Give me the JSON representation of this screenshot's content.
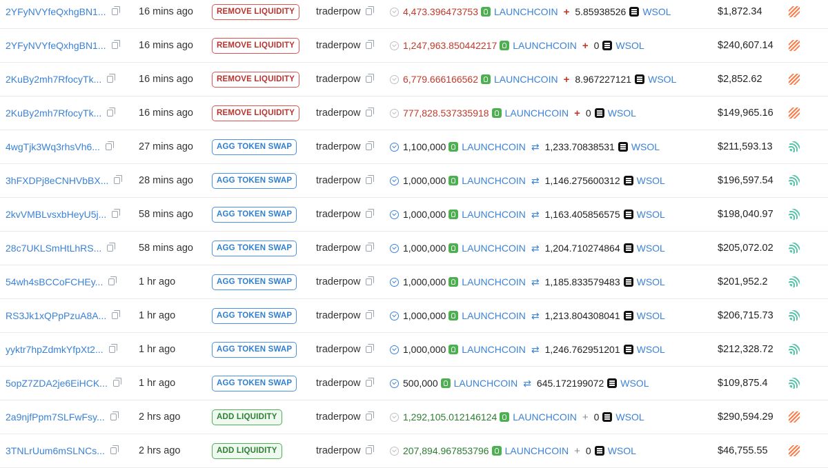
{
  "rows": [
    {
      "sig": "2YFyNVYfeQxhgBN1...",
      "time": "16 mins ago",
      "type": "REMOVE LIQUIDITY",
      "kind": "remove",
      "by": "traderpow",
      "amt1": "4,473.396473753",
      "tok1": "LAUNCHCOIN",
      "op": "+",
      "amt2": "5.85938526",
      "tok2": "WSOL",
      "value": "$1,872.34",
      "platform": "orange"
    },
    {
      "sig": "2YFyNVYfeQxhgBN1...",
      "time": "16 mins ago",
      "type": "REMOVE LIQUIDITY",
      "kind": "remove",
      "by": "traderpow",
      "amt1": "1,247,963.850442217",
      "tok1": "LAUNCHCOIN",
      "op": "+",
      "amt2": "0",
      "tok2": "WSOL",
      "value": "$240,607.14",
      "platform": "orange"
    },
    {
      "sig": "2KuBy2mh7RfocyTk...",
      "time": "16 mins ago",
      "type": "REMOVE LIQUIDITY",
      "kind": "remove",
      "by": "traderpow",
      "amt1": "6,779.666166562",
      "tok1": "LAUNCHCOIN",
      "op": "+",
      "amt2": "8.967227121",
      "tok2": "WSOL",
      "value": "$2,852.62",
      "platform": "orange"
    },
    {
      "sig": "2KuBy2mh7RfocyTk...",
      "time": "16 mins ago",
      "type": "REMOVE LIQUIDITY",
      "kind": "remove",
      "by": "traderpow",
      "amt1": "777,828.537335918",
      "tok1": "LAUNCHCOIN",
      "op": "+",
      "amt2": "0",
      "tok2": "WSOL",
      "value": "$149,965.16",
      "platform": "orange"
    },
    {
      "sig": "4wgTjk3Wq3rhsVh6...",
      "time": "27 mins ago",
      "type": "AGG TOKEN SWAP",
      "kind": "swap",
      "by": "traderpow",
      "amt1": "1,100,000",
      "tok1": "LAUNCHCOIN",
      "op": "⇄",
      "amt2": "1,233.70838531",
      "tok2": "WSOL",
      "value": "$211,593.13",
      "platform": "teal"
    },
    {
      "sig": "3hFXDPj8eCNHVbBX...",
      "time": "28 mins ago",
      "type": "AGG TOKEN SWAP",
      "kind": "swap",
      "by": "traderpow",
      "amt1": "1,000,000",
      "tok1": "LAUNCHCOIN",
      "op": "⇄",
      "amt2": "1,146.275600312",
      "tok2": "WSOL",
      "value": "$196,597.54",
      "platform": "teal"
    },
    {
      "sig": "2kvVMBLvsxbHeyU5j...",
      "time": "58 mins ago",
      "type": "AGG TOKEN SWAP",
      "kind": "swap",
      "by": "traderpow",
      "amt1": "1,000,000",
      "tok1": "LAUNCHCOIN",
      "op": "⇄",
      "amt2": "1,163.405856575",
      "tok2": "WSOL",
      "value": "$198,040.97",
      "platform": "teal"
    },
    {
      "sig": "28c7UKLSmHtLhRS...",
      "time": "58 mins ago",
      "type": "AGG TOKEN SWAP",
      "kind": "swap",
      "by": "traderpow",
      "amt1": "1,000,000",
      "tok1": "LAUNCHCOIN",
      "op": "⇄",
      "amt2": "1,204.710274864",
      "tok2": "WSOL",
      "value": "$205,072.02",
      "platform": "teal"
    },
    {
      "sig": "54wh4sBCCoFCHEy...",
      "time": "1 hr ago",
      "type": "AGG TOKEN SWAP",
      "kind": "swap",
      "by": "traderpow",
      "amt1": "1,000,000",
      "tok1": "LAUNCHCOIN",
      "op": "⇄",
      "amt2": "1,185.833579483",
      "tok2": "WSOL",
      "value": "$201,952.2",
      "platform": "teal"
    },
    {
      "sig": "RS3Jk1xQPpPzuA8A...",
      "time": "1 hr ago",
      "type": "AGG TOKEN SWAP",
      "kind": "swap",
      "by": "traderpow",
      "amt1": "1,000,000",
      "tok1": "LAUNCHCOIN",
      "op": "⇄",
      "amt2": "1,213.804308041",
      "tok2": "WSOL",
      "value": "$206,715.73",
      "platform": "teal"
    },
    {
      "sig": "yyktr7hpZdmkYfpXt2...",
      "time": "1 hr ago",
      "type": "AGG TOKEN SWAP",
      "kind": "swap",
      "by": "traderpow",
      "amt1": "1,000,000",
      "tok1": "LAUNCHCOIN",
      "op": "⇄",
      "amt2": "1,246.762951201",
      "tok2": "WSOL",
      "value": "$212,328.72",
      "platform": "teal"
    },
    {
      "sig": "5opZ7ZDA2je6EiHCK...",
      "time": "1 hr ago",
      "type": "AGG TOKEN SWAP",
      "kind": "swap",
      "by": "traderpow",
      "amt1": "500,000",
      "tok1": "LAUNCHCOIN",
      "op": "⇄",
      "amt2": "645.172199072",
      "tok2": "WSOL",
      "value": "$109,875.4",
      "platform": "teal"
    },
    {
      "sig": "2a9njfPpm7SLFwFsy...",
      "time": "2 hrs ago",
      "type": "ADD LIQUIDITY",
      "kind": "add",
      "by": "traderpow",
      "amt1": "1,292,105.012146124",
      "tok1": "LAUNCHCOIN",
      "op": "+",
      "amt2": "0",
      "tok2": "WSOL",
      "value": "$290,594.29",
      "platform": "orange"
    },
    {
      "sig": "3TNLrUum6mSLNCs...",
      "time": "2 hrs ago",
      "type": "ADD LIQUIDITY",
      "kind": "add",
      "by": "traderpow",
      "amt1": "207,894.967853796",
      "tok1": "LAUNCHCOIN",
      "op": "+",
      "amt2": "0",
      "tok2": "WSOL",
      "value": "$46,755.55",
      "platform": "orange"
    }
  ],
  "icons": {
    "copy": "copy-icon",
    "status": "check-circle-icon",
    "launchcoin": "launchcoin-token-icon",
    "wsol": "wsol-token-icon",
    "platform_orange": "raydium-platform-icon",
    "platform_teal": "aggregator-platform-icon"
  },
  "colors": {
    "remove": "#d9534f",
    "swap": "#4a90e2",
    "add": "#4caf50",
    "link": "#3b82d6"
  }
}
